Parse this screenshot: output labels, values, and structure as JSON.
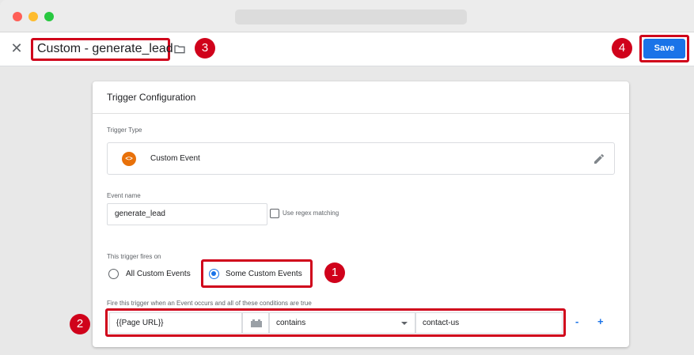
{
  "window": {
    "url": ""
  },
  "toolbar": {
    "close_icon": "close-icon",
    "trigger_name": "Custom - generate_lead",
    "folder_icon": "folder-icon",
    "save_label": "Save"
  },
  "annotations": {
    "one": "1",
    "two": "2",
    "three": "3",
    "four": "4"
  },
  "card": {
    "title": "Trigger Configuration",
    "trigger_type_label": "Trigger Type",
    "trigger_type_icon": "<>",
    "trigger_type_name": "Custom Event",
    "event_name_label": "Event name",
    "event_name_value": "generate_lead",
    "regex_label": "Use regex matching",
    "fires_on_label": "This trigger fires on",
    "option_all": "All Custom Events",
    "option_some": "Some Custom Events",
    "condition_label": "Fire this trigger when an Event occurs and all of these conditions are true",
    "condition": {
      "variable": "{{Page URL}}",
      "operator": "contains",
      "value": "contact-us"
    },
    "remove_label": "-",
    "add_label": "+"
  },
  "colors": {
    "accent": "#1a73e8",
    "highlight": "#d0021b",
    "type_icon": "#e8710a"
  }
}
